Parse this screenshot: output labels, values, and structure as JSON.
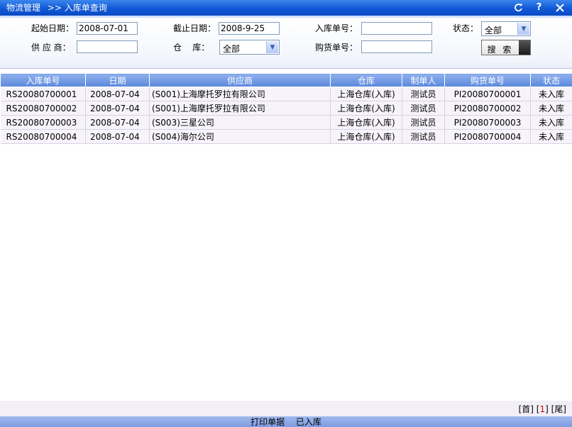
{
  "titlebar": {
    "crumb_module": "物流管理",
    "crumb_sep": ">>",
    "crumb_page": "入库单查询",
    "icons": [
      "refresh-icon",
      "help-icon",
      "close-icon"
    ]
  },
  "filters": {
    "start_date_label": "起始日期：",
    "start_date_value": "2008-07-01",
    "end_date_label": "截止日期：",
    "end_date_value": "2008-9-25",
    "receipt_no_label": "入库单号：",
    "receipt_no_value": "",
    "status_label": "状态：",
    "status_value": "全部",
    "supplier_label": "供 应 商：",
    "supplier_value": "",
    "warehouse_label": "仓    库：",
    "warehouse_value": "全部",
    "purchase_no_label": "购货单号：",
    "purchase_no_value": "",
    "search_label": "搜 索"
  },
  "table": {
    "columns": [
      "入库单号",
      "日期",
      "供应商",
      "仓库",
      "制单人",
      "购货单号",
      "状态"
    ],
    "rows": [
      [
        "RS20080700001",
        "2008-07-04",
        "(S001)上海摩托罗拉有限公司",
        "上海仓库(入库)",
        "测试员",
        "PI20080700001",
        "未入库"
      ],
      [
        "RS20080700002",
        "2008-07-04",
        "(S001)上海摩托罗拉有限公司",
        "上海仓库(入库)",
        "测试员",
        "PI20080700002",
        "未入库"
      ],
      [
        "RS20080700003",
        "2008-07-04",
        "(S003)三星公司",
        "上海仓库(入库)",
        "测试员",
        "PI20080700003",
        "未入库"
      ],
      [
        "RS20080700004",
        "2008-07-04",
        "(S004)海尔公司",
        "上海仓库(入库)",
        "测试员",
        "PI20080700004",
        "未入库"
      ]
    ]
  },
  "pager": {
    "first": "[首]",
    "current_open": "[",
    "current": "1",
    "current_close": "]",
    "last": "[尾]"
  },
  "footer": {
    "print_label": "打印单据",
    "stocked_label": "已入库"
  },
  "colors": {
    "titlebar": "#1158d6",
    "header": "#5b88dc",
    "row": "#f6f3fa",
    "current_page": "#d40000"
  }
}
